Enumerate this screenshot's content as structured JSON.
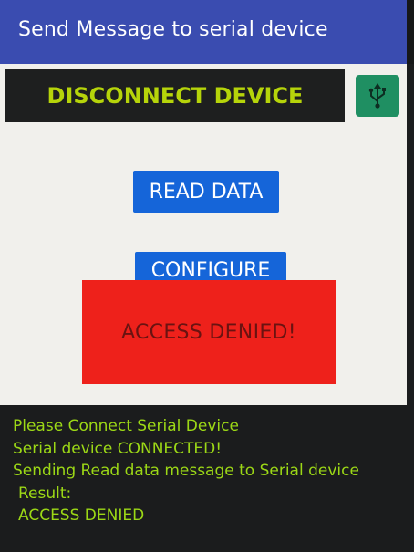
{
  "app_bar": {
    "title": "Send Message to serial device"
  },
  "buttons": {
    "disconnect_label": "DISCONNECT DEVICE",
    "usb_icon": "usb-icon",
    "read_label": "READ DATA",
    "configure_label": "CONFIGURE"
  },
  "alert": {
    "message": "ACCESS DENIED!"
  },
  "log": {
    "lines": [
      "Please Connect Serial Device",
      "Serial device CONNECTED!",
      "Sending Read data message to Serial device",
      "Result:",
      "ACCESS DENIED"
    ]
  },
  "colors": {
    "app_bar": "#3a4cb0",
    "button_blue": "#1565d9",
    "alert_red": "#ee211b",
    "log_green": "#9cd816",
    "disconnect_text": "#b6d40a",
    "usb_button": "#1f8f62"
  }
}
